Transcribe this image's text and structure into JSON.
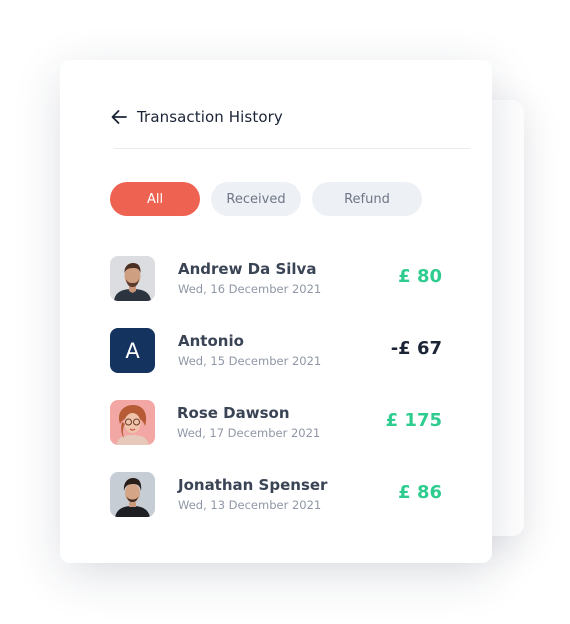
{
  "header": {
    "title": "Transaction History",
    "back_icon": "arrow-left-icon"
  },
  "filters": [
    {
      "label": "All",
      "active": true
    },
    {
      "label": "Received",
      "active": false
    },
    {
      "label": "Refund",
      "active": false
    }
  ],
  "transactions": [
    {
      "name": "Andrew Da Silva",
      "date": "Wed, 16 December 2021",
      "amount": "£ 80",
      "type": "positive"
    },
    {
      "name": "Antonio",
      "date": "Wed, 15 December 2021",
      "amount": "-£ 67",
      "type": "negative",
      "avatar_letter": "A"
    },
    {
      "name": "Rose Dawson",
      "date": "Wed, 17 December 2021",
      "amount": "£ 175",
      "type": "positive"
    },
    {
      "name": "Jonathan Spenser",
      "date": "Wed, 13 December 2021",
      "amount": "£ 86",
      "type": "positive"
    }
  ],
  "colors": {
    "accent": "#ee6251",
    "positive": "#2ecc8f",
    "negative": "#1c2536",
    "avatar_bg": "#15335f"
  }
}
